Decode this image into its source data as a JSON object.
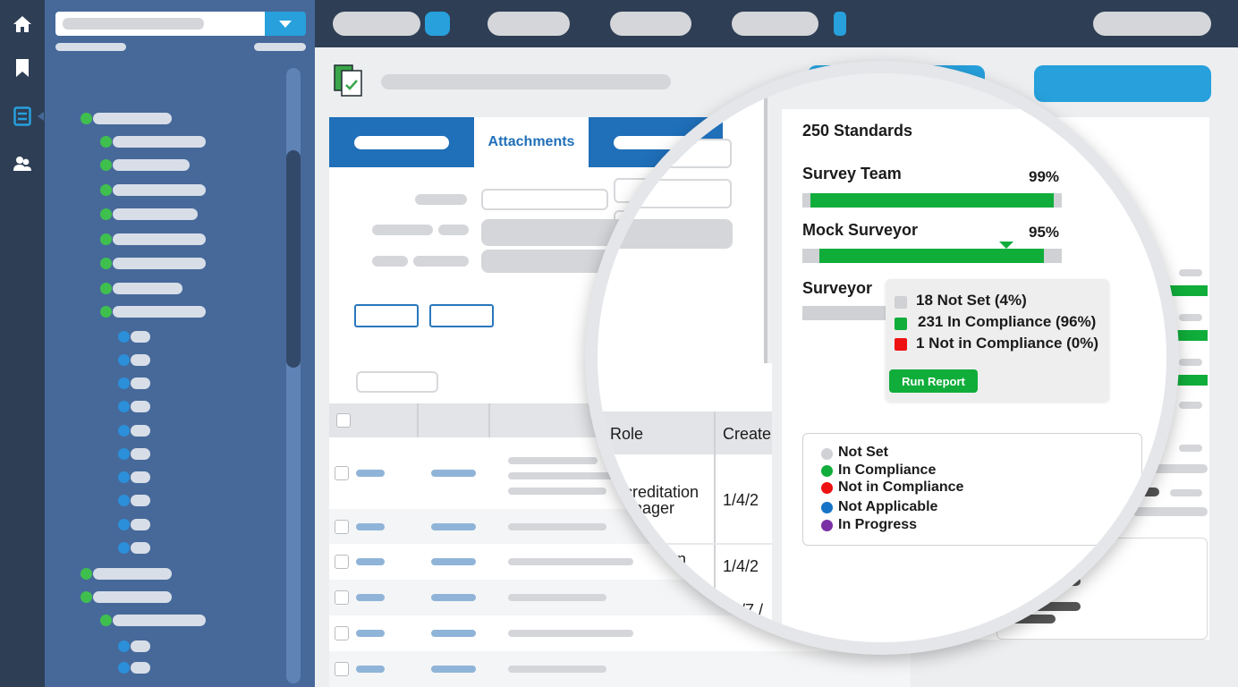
{
  "tabs": {
    "attachments": "Attachments"
  },
  "table": {
    "columns": {
      "role": "Role",
      "created": "Create"
    },
    "rows": [
      {
        "role": "creditation",
        "role2": "nager",
        "date": "1/4/2"
      },
      {
        "role": "tion",
        "date": "1/4/2"
      },
      {
        "date": "/7 /"
      }
    ]
  },
  "summary": {
    "total": "250 Standards",
    "teams": [
      {
        "name": "Survey Team",
        "percent": "99%",
        "fill": 0.97
      },
      {
        "name": "Mock Surveyor",
        "percent": "95%",
        "fill": 0.93
      },
      {
        "name": "Surveyor"
      }
    ],
    "tooltip": {
      "items": [
        {
          "label": "18 Not Set (4%)",
          "color": "#cfd1d4"
        },
        {
          "label": "231 In Compliance (96%)",
          "color": "#10ad3b"
        },
        {
          "label": "1 Not in Compliance (0%)",
          "color": "#ee1111"
        }
      ],
      "run_report": "Run Report"
    },
    "legend": [
      {
        "label": "Not Set",
        "color": "#cfd1d4"
      },
      {
        "label": "In Compliance",
        "color": "#10ad3b"
      },
      {
        "label": "Not in Compliance",
        "color": "#ee1111"
      },
      {
        "label": "Not Applicable",
        "color": "#1673c7"
      },
      {
        "label": "In Progress",
        "color": "#7b2fa5"
      }
    ]
  },
  "colors": {
    "accent": "#27a0dc",
    "nav": "#2e3e55",
    "tree": "#46699a",
    "green": "#10ad3b"
  },
  "icons": {
    "rail": [
      "home-icon",
      "bookmark-icon",
      "standards-icon",
      "users-icon"
    ],
    "page": "document-check-icon"
  }
}
